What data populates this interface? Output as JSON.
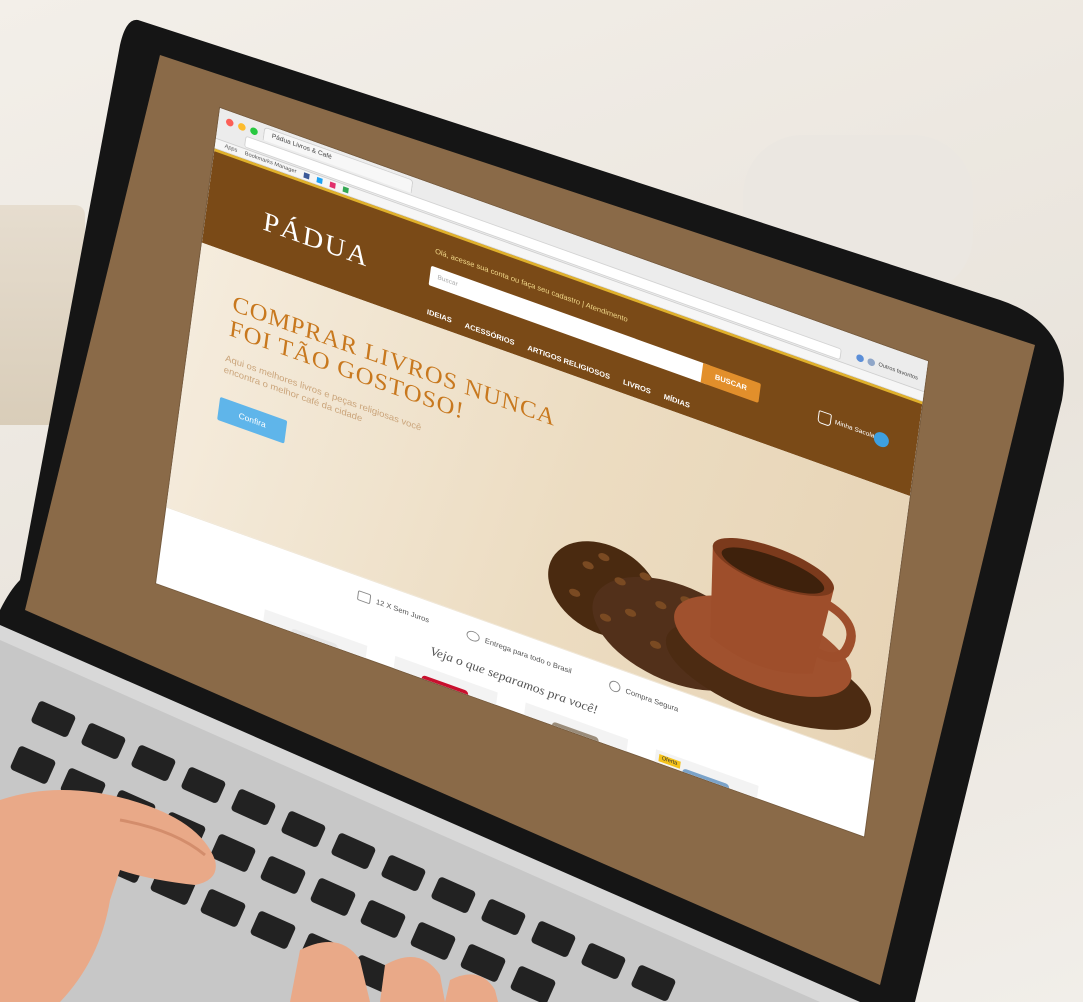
{
  "browser": {
    "tab_title": "Pádua Livros & Café",
    "bookmarks": [
      "Apps",
      "Bookmarks Manager"
    ],
    "profile_label": "Outros favoritos"
  },
  "site": {
    "logo": "PÁDUA",
    "promo_text": "Olá, acesse sua conta ou faça seu cadastro | Atendimento",
    "search_placeholder": "Buscar",
    "search_button": "BUSCAR",
    "cart_label": "Minha Sacola",
    "nav": [
      "IDEIAS",
      "ACESSÓRIOS",
      "ARTIGOS RELIGIOSOS",
      "LIVROS",
      "MÍDIAS"
    ],
    "hero": {
      "title": "COMPRAR LIVROS NUNCA FOI TÃO GOSTOSO!",
      "subtitle": "Aqui os melhores livros e peças religiosas você encontra o melhor café da cidade",
      "button": "Confira"
    },
    "features": [
      "12 X Sem Juros",
      "Entrega para todo o Brasil",
      "Compra Segura"
    ],
    "picks_title": "Veja o que separamos pra você!",
    "products": [
      {
        "thumb_color": "#e7e7e7",
        "badge": ""
      },
      {
        "thumb_color": "#c8102e",
        "badge": ""
      },
      {
        "thumb_color": "#9a8c7a",
        "badge": ""
      },
      {
        "thumb_color": "#7ba3c9",
        "badge": "Oferta"
      }
    ]
  },
  "colors": {
    "header_brown": "#7a4a17",
    "accent_gold": "#e0b12b",
    "search_orange": "#e28f2b",
    "hero_button_blue": "#5fb5ea",
    "screen_bezel_brown": "#8a6a48"
  }
}
